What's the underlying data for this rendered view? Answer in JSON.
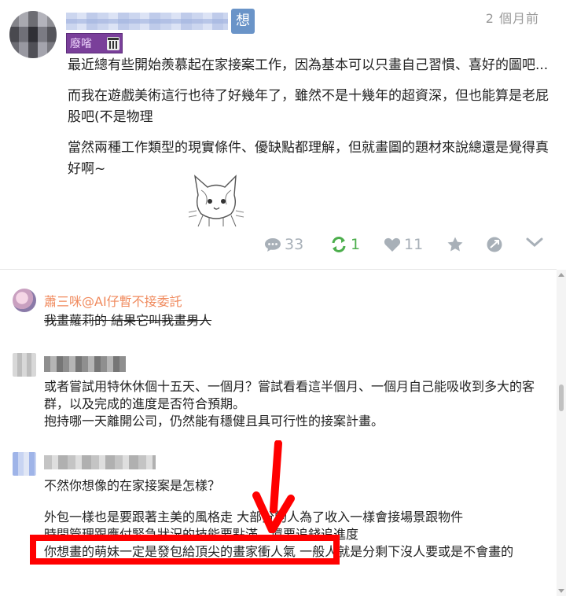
{
  "post": {
    "tag": "想",
    "time": "2 個月前",
    "title_badge": "廢㗂",
    "paragraphs": [
      "最近總有些開始羨慕起在家接案工作，因為基本可以只畫自己習慣、喜好的圖吧...",
      "而我在遊戲美術這行也待了好幾年了，雖然不是十幾年的超資深，但也能算是老屁股吧(不是物理",
      "當然兩種工作類型的現實條件、優缺點都理解，但就畫圖的題材來說總還是覺得真好啊~"
    ],
    "actions": {
      "comments": "33",
      "reposts": "1",
      "likes": "11"
    }
  },
  "comments": [
    {
      "author": "蕭三咪@AI仔暫不接委託",
      "lines": [
        "我畫蘿莉的 結果它叫我畫男人"
      ]
    },
    {
      "lines": [
        "或者嘗試用特休休個十五天、一個月？嘗試看看這半個月、一個月自己能吸收到多大的客群，以及完成的進度是否符合預期。",
        "抱持哪一天離開公司，仍然能有穩健且具可行性的接案計畫。"
      ]
    },
    {
      "lines": [
        "不然你想像的在家接案是怎樣？",
        "外包一樣也是要跟著主美的風格走 大部分的人為了收入一樣會接場景跟物件",
        "時間管理跟應付緊急狀況的技能要點滿，還要追錢追進度",
        "你想畫的萌妹一定是發包給頂尖的畫家衝人氣 一般人就是分剩下沒人要或是不會畫的"
      ]
    }
  ],
  "colors": {
    "accent_orange": "#f08a5d",
    "repost_green": "#4cae4c",
    "icon_gray": "#a8b0b8",
    "highlight_red": "#ff0000",
    "tag_blue": "#6a94c8",
    "title_purple": "#7a3f9a"
  },
  "icons": [
    "comment-icon",
    "repost-icon",
    "heart-icon",
    "star-icon",
    "share-icon",
    "chevron-down-icon",
    "trash-icon"
  ]
}
